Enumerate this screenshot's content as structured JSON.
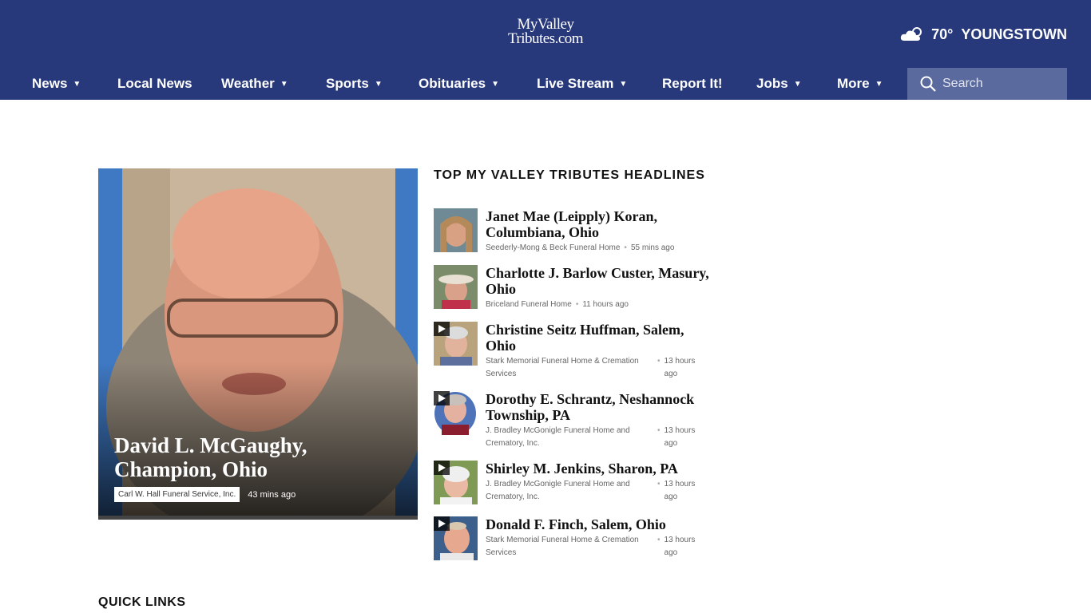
{
  "header": {
    "logo_line1": "MyValley",
    "logo_line2": "Tributes.com",
    "weather": {
      "icon": "cloud-sun-icon",
      "temp": "70°",
      "city": "YOUNGSTOWN"
    }
  },
  "nav": [
    {
      "label": "News",
      "caret": true
    },
    {
      "label": "Local News",
      "caret": false
    },
    {
      "label": "Weather",
      "caret": true
    },
    {
      "label": "Sports",
      "caret": true
    },
    {
      "label": "Obituaries",
      "caret": true
    },
    {
      "label": "Live Stream",
      "caret": true
    },
    {
      "label": "Report It!",
      "caret": false
    },
    {
      "label": "Jobs",
      "caret": true
    },
    {
      "label": "More",
      "caret": true
    }
  ],
  "search": {
    "placeholder": "Search"
  },
  "feature": {
    "title": "David L. McGaughy, Champion, Ohio",
    "source": "Carl W. Hall Funeral Service, Inc.",
    "time": "43 mins ago"
  },
  "headlines": {
    "title": "TOP MY VALLEY TRIBUTES HEADLINES",
    "items": [
      {
        "title": "Janet Mae (Leipply) Koran, Columbiana, Ohio",
        "source": "Seederly-Mong & Beck Funeral Home",
        "time": "55 mins ago",
        "video": false
      },
      {
        "title": "Charlotte J. Barlow Custer, Masury, Ohio",
        "source": "Briceland Funeral Home",
        "time": "11 hours ago",
        "video": false
      },
      {
        "title": "Christine Seitz Huffman, Salem, Ohio",
        "source": "Stark Memorial Funeral Home & Cremation Services",
        "time": "13 hours ago",
        "video": true
      },
      {
        "title": "Dorothy E. Schrantz, Neshannock Township, PA",
        "source": "J. Bradley McGonigle Funeral Home and Crematory, Inc.",
        "time": "13 hours ago",
        "video": true
      },
      {
        "title": "Shirley M. Jenkins, Sharon, PA",
        "source": "J. Bradley McGonigle Funeral Home and Crematory, Inc.",
        "time": "13 hours ago",
        "video": true
      },
      {
        "title": "Donald F. Finch, Salem, Ohio",
        "source": "Stark Memorial Funeral Home & Cremation Services",
        "time": "13 hours ago",
        "video": true
      }
    ]
  },
  "quick_links": {
    "title": "QUICK LINKS"
  }
}
